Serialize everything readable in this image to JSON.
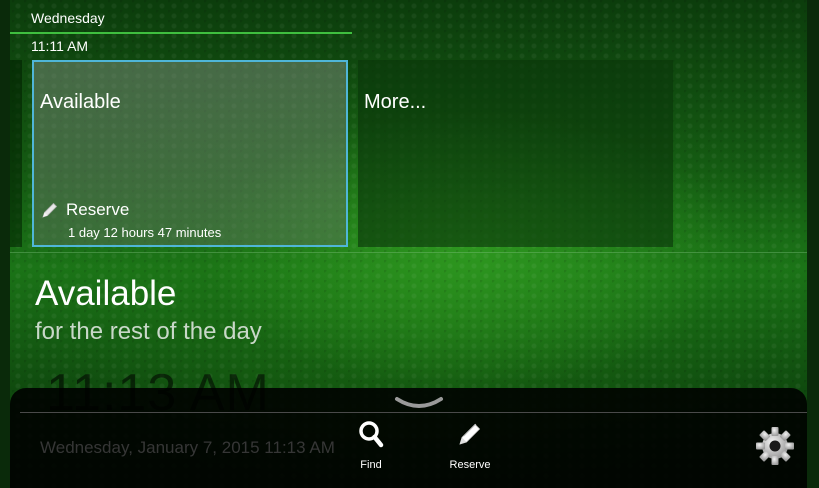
{
  "header": {
    "day": "Wednesday",
    "time": "11:11 AM"
  },
  "tiles": [
    {
      "title": "Available",
      "action_label": "Reserve",
      "duration": "1 day 12 hours 47 minutes",
      "selected": true
    },
    {
      "title": "More..."
    }
  ],
  "status": {
    "title": "Available",
    "subtitle": "for the rest of the day",
    "big_time": "11:13 AM",
    "date_line": "Wednesday, January 7, 2015 11:13 AM"
  },
  "toolbar": {
    "find_label": "Find",
    "reserve_label": "Reserve",
    "icons": {
      "find": "search-icon",
      "reserve": "pencil-icon",
      "settings": "gear-icon",
      "expand": "chevron-up-icon"
    }
  },
  "colors": {
    "accent_border": "#4fb6d8",
    "header_line": "#3fbf3f"
  }
}
